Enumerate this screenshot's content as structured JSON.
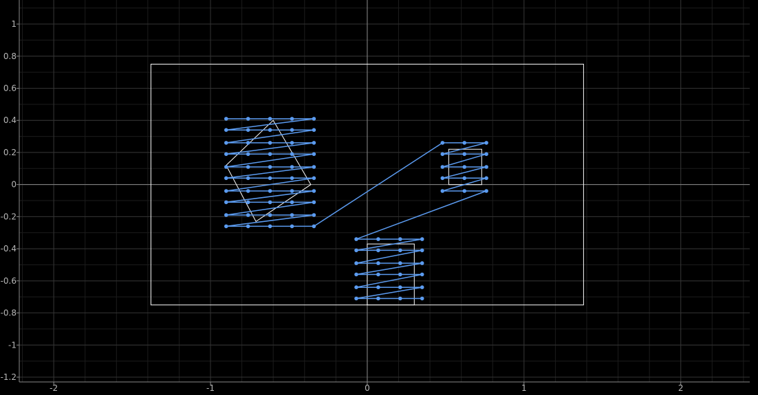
{
  "chart_data": {
    "type": "scatter",
    "title": "",
    "xlabel": "",
    "ylabel": "",
    "xlim": [
      -2.22,
      2.44
    ],
    "ylim": [
      -1.23,
      1.15
    ],
    "x_major_step": 1,
    "y_major_step": 0.2,
    "x_ticks": [
      "-2",
      "-1",
      "0",
      "1",
      "2"
    ],
    "y_ticks": [
      "1",
      "0.8",
      "0.6",
      "0.4",
      "0.2",
      "0",
      "-0.2",
      "-0.4",
      "-0.6",
      "-0.8",
      "-1",
      "-1.2"
    ],
    "grid": true,
    "colors": {
      "background": "#000000",
      "series": "#5b9bf0",
      "outline": "#ffffff"
    },
    "outlines": [
      {
        "name": "outer-rectangle",
        "points": [
          [
            -1.38,
            0.75
          ],
          [
            1.38,
            0.75
          ],
          [
            1.38,
            -0.75
          ],
          [
            -1.38,
            -0.75
          ]
        ]
      },
      {
        "name": "tilted-square",
        "points": [
          [
            -0.6,
            0.4
          ],
          [
            -0.36,
            0.0
          ],
          [
            -0.71,
            -0.23
          ],
          [
            -0.9,
            0.12
          ]
        ]
      },
      {
        "name": "small-right-square",
        "points": [
          [
            0.52,
            0.22
          ],
          [
            0.73,
            0.22
          ],
          [
            0.73,
            0.0
          ],
          [
            0.52,
            0.0
          ]
        ]
      },
      {
        "name": "bottom-rectangle",
        "points": [
          [
            0.0,
            -0.37
          ],
          [
            0.3,
            -0.37
          ],
          [
            0.3,
            -0.75
          ],
          [
            0.0,
            -0.75
          ]
        ]
      }
    ],
    "series": [
      {
        "points": [
          [
            -0.9,
            0.41
          ],
          [
            -0.76,
            0.41
          ],
          [
            -0.62,
            0.41
          ],
          [
            -0.48,
            0.41
          ],
          [
            -0.34,
            0.41
          ],
          [
            -0.9,
            0.34
          ],
          [
            -0.76,
            0.34
          ],
          [
            -0.62,
            0.34
          ],
          [
            -0.48,
            0.34
          ],
          [
            -0.34,
            0.34
          ],
          [
            -0.9,
            0.26
          ],
          [
            -0.76,
            0.26
          ],
          [
            -0.62,
            0.26
          ],
          [
            -0.48,
            0.26
          ],
          [
            -0.34,
            0.26
          ],
          [
            -0.9,
            0.19
          ],
          [
            -0.76,
            0.19
          ],
          [
            -0.62,
            0.19
          ],
          [
            -0.48,
            0.19
          ],
          [
            -0.34,
            0.19
          ],
          [
            -0.9,
            0.11
          ],
          [
            -0.76,
            0.11
          ],
          [
            -0.62,
            0.11
          ],
          [
            -0.48,
            0.11
          ],
          [
            -0.34,
            0.11
          ],
          [
            -0.9,
            0.04
          ],
          [
            -0.76,
            0.04
          ],
          [
            -0.62,
            0.04
          ],
          [
            -0.48,
            0.04
          ],
          [
            -0.34,
            0.04
          ],
          [
            -0.9,
            -0.04
          ],
          [
            -0.76,
            -0.04
          ],
          [
            -0.62,
            -0.04
          ],
          [
            -0.48,
            -0.04
          ],
          [
            -0.34,
            -0.04
          ],
          [
            -0.9,
            -0.11
          ],
          [
            -0.76,
            -0.11
          ],
          [
            -0.62,
            -0.11
          ],
          [
            -0.48,
            -0.11
          ],
          [
            -0.34,
            -0.11
          ],
          [
            -0.9,
            -0.19
          ],
          [
            -0.76,
            -0.19
          ],
          [
            -0.62,
            -0.19
          ],
          [
            -0.48,
            -0.19
          ],
          [
            -0.34,
            -0.19
          ],
          [
            -0.9,
            -0.26
          ],
          [
            -0.76,
            -0.26
          ],
          [
            -0.62,
            -0.26
          ],
          [
            -0.48,
            -0.26
          ],
          [
            -0.34,
            -0.26
          ],
          [
            0.48,
            0.26
          ],
          [
            0.62,
            0.26
          ],
          [
            0.76,
            0.26
          ],
          [
            0.48,
            0.19
          ],
          [
            0.62,
            0.19
          ],
          [
            0.76,
            0.19
          ],
          [
            0.48,
            0.11
          ],
          [
            0.62,
            0.11
          ],
          [
            0.76,
            0.11
          ],
          [
            0.48,
            0.04
          ],
          [
            0.62,
            0.04
          ],
          [
            0.76,
            0.04
          ],
          [
            0.48,
            -0.04
          ],
          [
            0.62,
            -0.04
          ],
          [
            0.76,
            -0.04
          ],
          [
            -0.07,
            -0.34
          ],
          [
            0.07,
            -0.34
          ],
          [
            0.21,
            -0.34
          ],
          [
            0.35,
            -0.34
          ],
          [
            -0.07,
            -0.41
          ],
          [
            0.07,
            -0.41
          ],
          [
            0.21,
            -0.41
          ],
          [
            0.35,
            -0.41
          ],
          [
            -0.07,
            -0.49
          ],
          [
            0.07,
            -0.49
          ],
          [
            0.21,
            -0.49
          ],
          [
            0.35,
            -0.49
          ],
          [
            -0.07,
            -0.56
          ],
          [
            0.07,
            -0.56
          ],
          [
            0.21,
            -0.56
          ],
          [
            0.35,
            -0.56
          ],
          [
            -0.07,
            -0.64
          ],
          [
            0.07,
            -0.64
          ],
          [
            0.21,
            -0.64
          ],
          [
            0.35,
            -0.64
          ],
          [
            -0.07,
            -0.71
          ],
          [
            0.07,
            -0.71
          ],
          [
            0.21,
            -0.71
          ],
          [
            0.35,
            -0.71
          ]
        ]
      }
    ]
  }
}
